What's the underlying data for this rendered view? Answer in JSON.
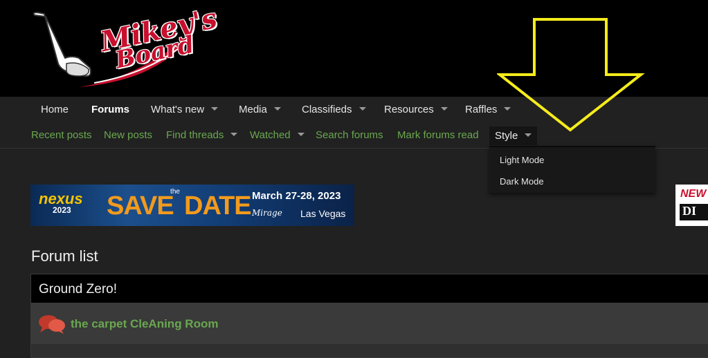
{
  "logo": {
    "line1": "Mikey's",
    "line2": "Board"
  },
  "nav": {
    "items": [
      {
        "label": "Home"
      },
      {
        "label": "Forums"
      },
      {
        "label": "What's new"
      },
      {
        "label": "Media"
      },
      {
        "label": "Classifieds"
      },
      {
        "label": "Resources"
      },
      {
        "label": "Raffles"
      }
    ]
  },
  "subnav": {
    "items": [
      {
        "label": "Recent posts"
      },
      {
        "label": "New posts"
      },
      {
        "label": "Find threads"
      },
      {
        "label": "Watched"
      },
      {
        "label": "Search forums"
      },
      {
        "label": "Mark forums read"
      },
      {
        "label": "Style"
      }
    ]
  },
  "style_menu": {
    "items": [
      {
        "label": "Light Mode"
      },
      {
        "label": "Dark Mode"
      }
    ]
  },
  "banner": {
    "brand": "nexus",
    "year": "2023",
    "save": "SAVE",
    "the": "the",
    "date": "DATE",
    "when": "March 27-28, 2023",
    "venue_logo": "Mirage",
    "where": "Las Vegas"
  },
  "side_ad": {
    "new": "NEW",
    "di": "DI"
  },
  "forum_list": {
    "title": "Forum list",
    "category": "Ground Zero!",
    "nodes": [
      {
        "title": "the carpet CleAning Room",
        "icon": "speech-bubbles-icon"
      }
    ]
  },
  "colors": {
    "link_green": "#6aa84f",
    "accent_red": "#c8102e",
    "arrow_yellow": "#f5ec1c"
  }
}
